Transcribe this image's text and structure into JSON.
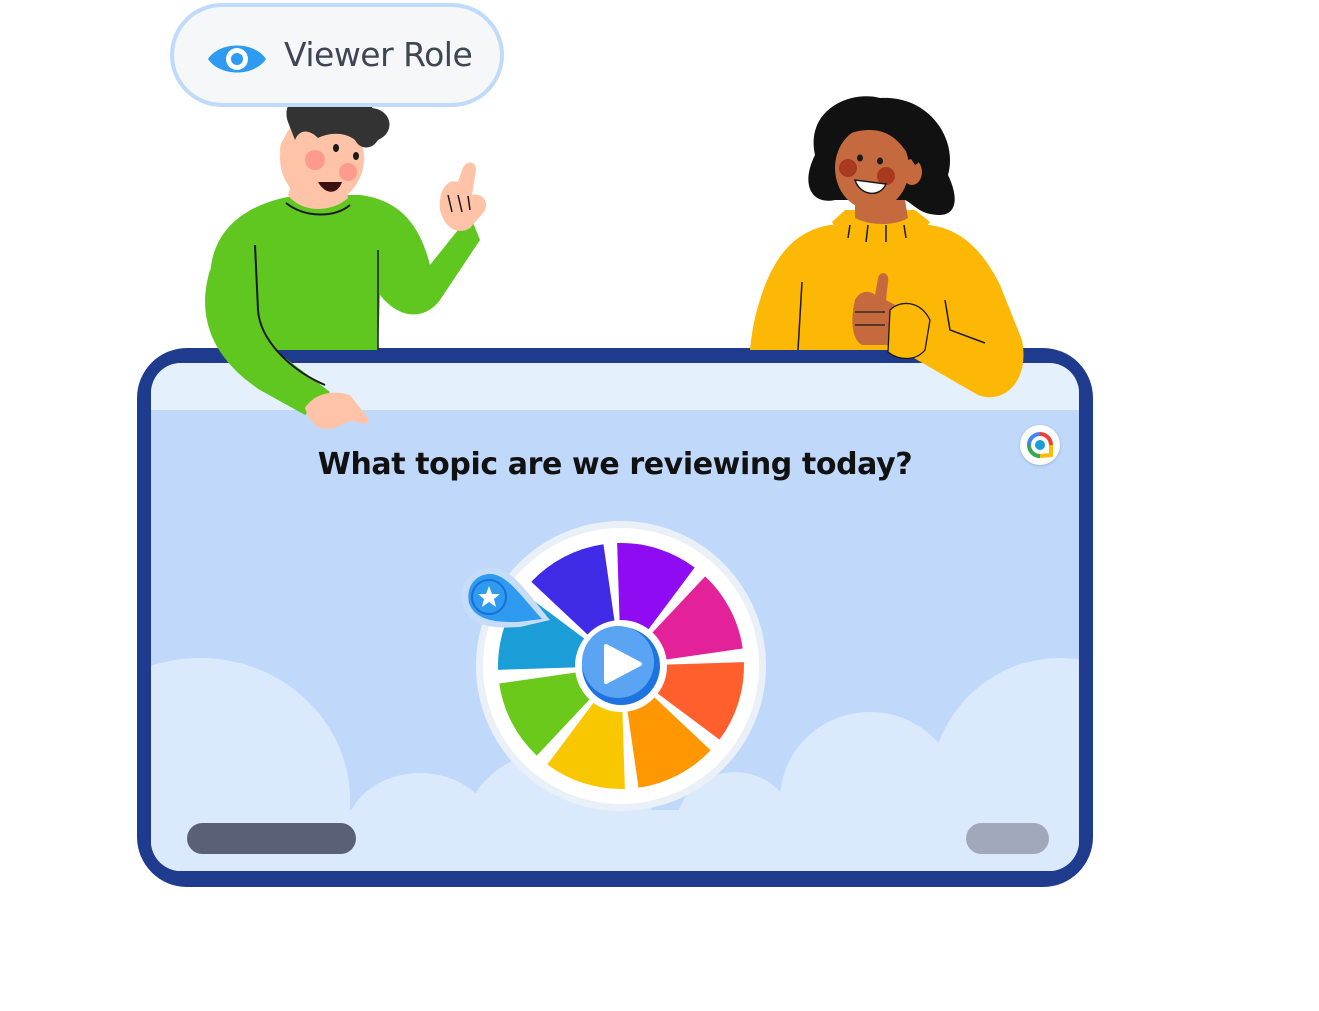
{
  "role_badge": {
    "label": "Viewer Role",
    "icon": "eye-icon"
  },
  "screen": {
    "question": "What topic are we reviewing today?",
    "logo_icon": "app-logo-icon",
    "left_bar_color": "#5a6177",
    "right_bar_color": "#a1a8bb"
  },
  "wheel": {
    "play_icon": "play-icon",
    "pointer_icon": "star-icon",
    "segment_colors": [
      "#8f0cf2",
      "#e3229a",
      "#ff5f2c",
      "#ff9703",
      "#f9c700",
      "#6ac91a",
      "#1b9dd8",
      "#3f2ae6"
    ]
  },
  "colors": {
    "frame": "#1e3b8e",
    "screen_bg": "#c0d9fb",
    "accent_blue": "#2e9bf0"
  }
}
